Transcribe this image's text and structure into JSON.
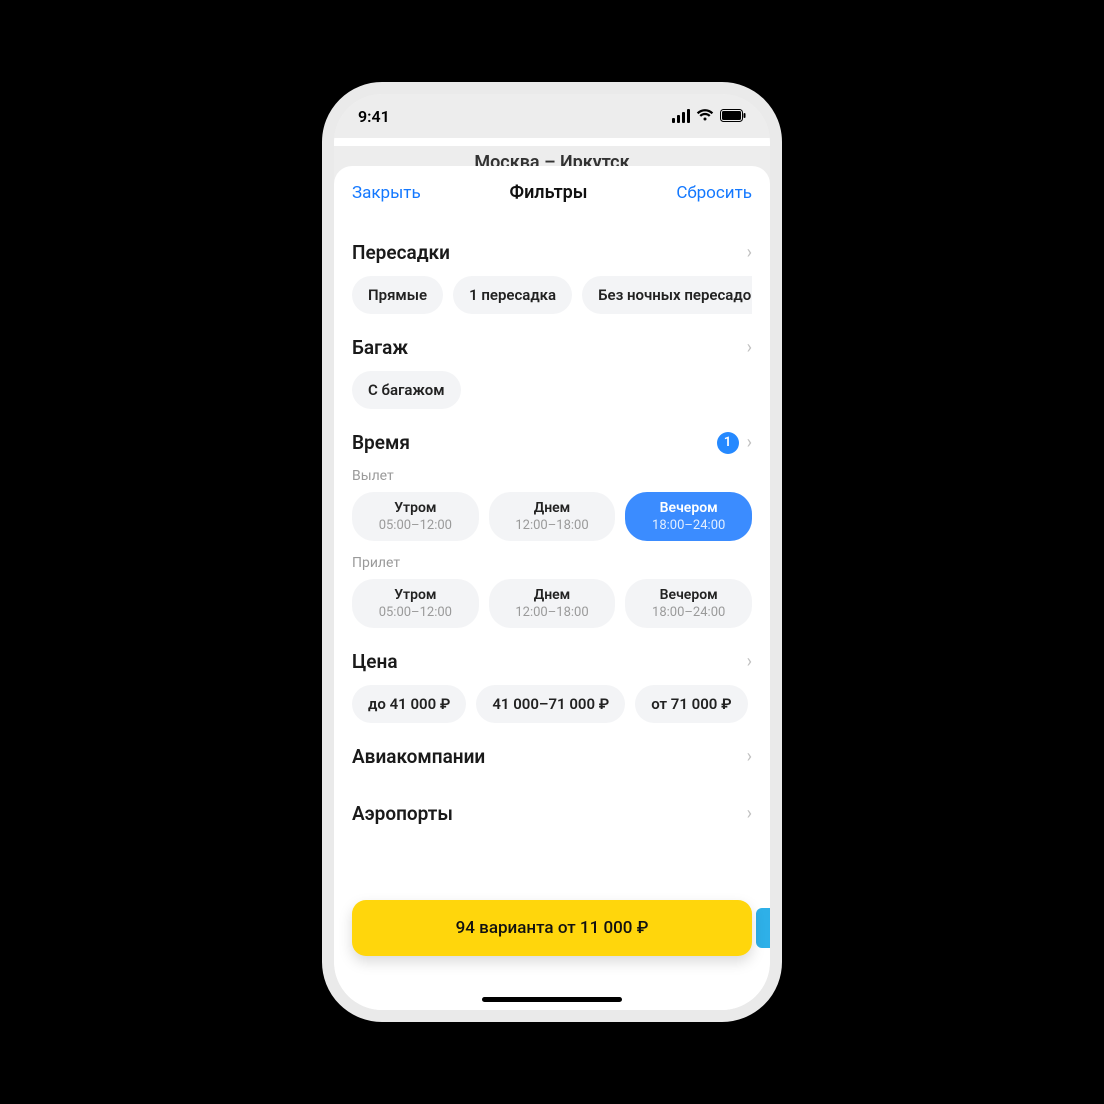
{
  "status": {
    "time": "9:41"
  },
  "background": {
    "title": "Москва – Иркутск"
  },
  "sheet": {
    "close": "Закрыть",
    "title": "Фильтры",
    "reset": "Сбросить"
  },
  "sections": {
    "transfers": {
      "title": "Пересадки",
      "chips": [
        "Прямые",
        "1 пересадка",
        "Без ночных пересадок"
      ]
    },
    "baggage": {
      "title": "Багаж",
      "chips": [
        "С багажом"
      ]
    },
    "time": {
      "title": "Время",
      "badge": "1",
      "departure_label": "Вылет",
      "arrival_label": "Прилет",
      "slots": [
        {
          "label": "Утром",
          "range": "05:00–12:00"
        },
        {
          "label": "Днем",
          "range": "12:00–18:00"
        },
        {
          "label": "Вечером",
          "range": "18:00–24:00"
        }
      ],
      "departure_active_index": 2
    },
    "price": {
      "title": "Цена",
      "chips": [
        "до 41 000 ₽",
        "41 000–71 000 ₽",
        "от 71 000 ₽"
      ]
    },
    "airlines": {
      "title": "Авиакомпании"
    },
    "airports": {
      "title": "Аэропорты"
    }
  },
  "cta": "94 варианта от 11 000 ₽"
}
